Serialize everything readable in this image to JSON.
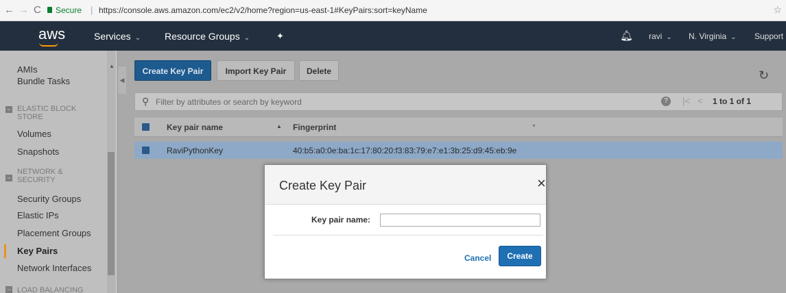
{
  "browser": {
    "back": "←",
    "forward": "→",
    "reload": "C",
    "secure_label": "Secure",
    "url": "https://console.aws.amazon.com/ec2/v2/home?region=us-east-1#KeyPairs:sort=keyName",
    "bookmark_icon": "☆"
  },
  "topnav": {
    "logo": "aws",
    "services": "Services",
    "resource_groups": "Resource Groups",
    "pin_icon": "pushpin-icon",
    "bell_icon": "bell-icon",
    "user": "ravi",
    "region": "N. Virginia",
    "support": "Support"
  },
  "sidebar": {
    "items": [
      {
        "label": "AMIs"
      },
      {
        "label": "Bundle Tasks"
      },
      {
        "category": "ELASTIC BLOCK STORE"
      },
      {
        "label": "Volumes"
      },
      {
        "label": "Snapshots"
      },
      {
        "category": "NETWORK & SECURITY"
      },
      {
        "label": "Security Groups"
      },
      {
        "label": "Elastic IPs"
      },
      {
        "label": "Placement Groups"
      },
      {
        "label": "Key Pairs",
        "active": true
      },
      {
        "label": "Network Interfaces"
      },
      {
        "category": "LOAD BALANCING"
      }
    ]
  },
  "toolbar": {
    "create_key_pair": "Create Key Pair",
    "import_key_pair": "Import Key Pair",
    "delete": "Delete"
  },
  "filter": {
    "placeholder": "Filter by attributes or search by keyword",
    "pagination": "1 to 1 of 1"
  },
  "table": {
    "columns": [
      "Key pair name",
      "Fingerprint"
    ],
    "rows": [
      {
        "name": "RaviPythonKey",
        "fingerprint": "40:b5:a0:0e:ba:1c:17:80:20:f3:83:79:e7:e1:3b:25:d9:45:eb:9e",
        "selected": true
      }
    ]
  },
  "modal": {
    "title": "Create Key Pair",
    "close": "×",
    "field_label": "Key pair name:",
    "field_value": "",
    "cancel": "Cancel",
    "create": "Create"
  },
  "colors": {
    "aws_nav": "#232f3e",
    "aws_orange": "#ff9900",
    "primary_button": "#1f6fb3",
    "overlay": "#a9a9a9"
  }
}
